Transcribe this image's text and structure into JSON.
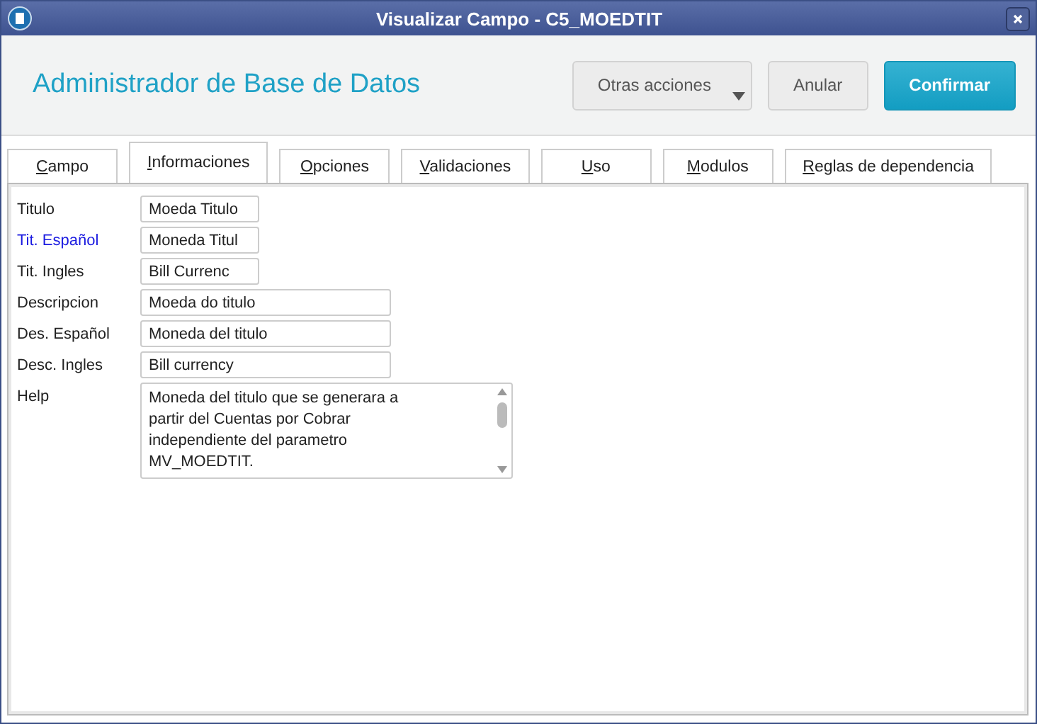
{
  "window": {
    "title": "Visualizar Campo - C5_MOEDTIT"
  },
  "header": {
    "title": "Administrador de Base de Datos",
    "buttons": [
      {
        "label": "Otras acciones",
        "kind": "menu"
      },
      {
        "label": "Anular",
        "kind": "plain"
      },
      {
        "label": "Confirmar",
        "kind": "primary"
      }
    ]
  },
  "tabs": [
    {
      "label": "Campo",
      "selected": false
    },
    {
      "label": "Informaciones",
      "selected": true
    },
    {
      "label": "Opciones",
      "selected": false
    },
    {
      "label": "Validaciones",
      "selected": false
    },
    {
      "label": "Uso",
      "selected": false
    },
    {
      "label": "Modulos",
      "selected": false
    },
    {
      "label": "Reglas de dependencia",
      "selected": false
    }
  ],
  "fields": [
    {
      "label": "Titulo",
      "value": "Moeda Titulo",
      "kind": "short",
      "highlighted": false
    },
    {
      "label": "Tit. Español",
      "value": "Moneda Titul",
      "kind": "short",
      "highlighted": true
    },
    {
      "label": "Tit. Ingles",
      "value": "Bill Currenc",
      "kind": "short",
      "highlighted": false
    },
    {
      "label": "Descripcion",
      "value": "Moeda do titulo",
      "kind": "long",
      "highlighted": false
    },
    {
      "label": "Des. Español",
      "value": "Moneda del titulo",
      "kind": "long",
      "highlighted": false
    },
    {
      "label": "Desc. Ingles",
      "value": "Bill currency",
      "kind": "long",
      "highlighted": false
    },
    {
      "label": "Help",
      "value": "Moneda del titulo que se generara a\npartir del Cuentas por Cobrar\nindependiente del parametro\nMV_MOEDTIT.",
      "kind": "memo",
      "highlighted": false
    }
  ]
}
